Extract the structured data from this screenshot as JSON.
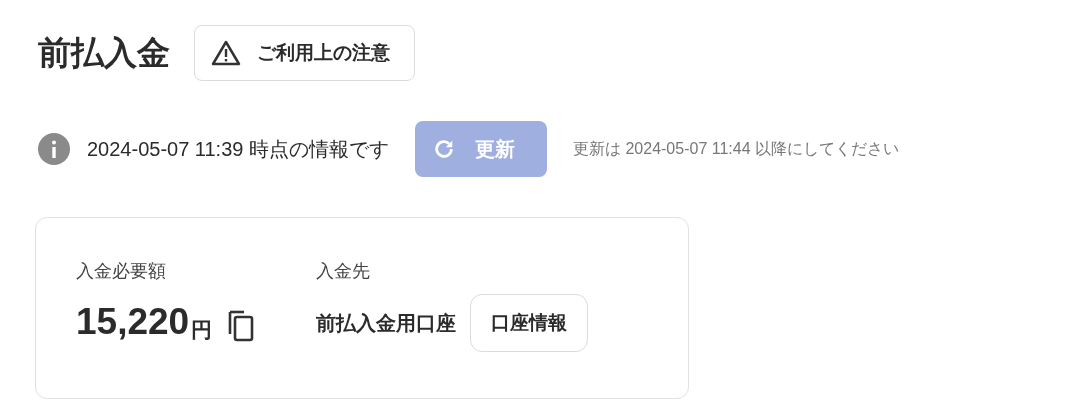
{
  "title": "前払入金",
  "notice_button": {
    "label": "ご利用上の注意"
  },
  "info": {
    "text": "2024-05-07 11:39 時点の情報です",
    "refresh_button": {
      "label": "更新",
      "disabled": true
    },
    "hint": "更新は 2024-05-07 11:44 以降にしてください"
  },
  "card": {
    "amount": {
      "label": "入金必要額",
      "value": "15,220",
      "unit": "円"
    },
    "destination": {
      "label": "入金先",
      "value": "前払入金用口座",
      "button": "口座情報"
    }
  }
}
